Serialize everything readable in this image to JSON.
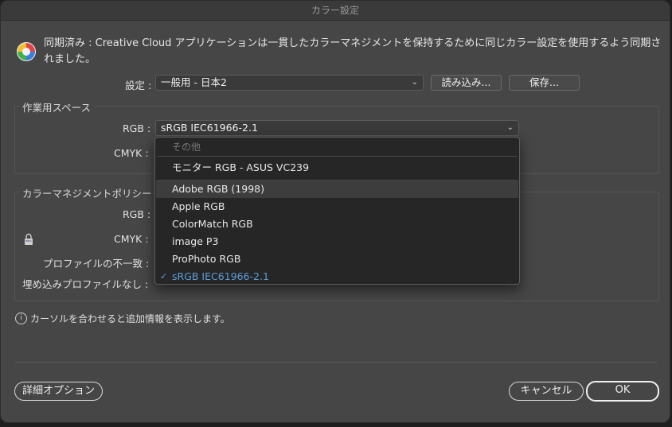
{
  "window": {
    "title": "カラー設定"
  },
  "sync": {
    "message": "同期済み : Creative Cloud アプリケーションは一貫したカラーマネジメントを保持するために同じカラー設定を使用するよう同期されました。"
  },
  "settings": {
    "label": "設定 :",
    "value": "一般用 - 日本2",
    "load_button": "読み込み...",
    "save_button": "保存..."
  },
  "working_spaces": {
    "title": "作業用スペース",
    "rgb_label": "RGB :",
    "rgb_value": "sRGB IEC61966-2.1",
    "cmyk_label": "CMYK :"
  },
  "policies": {
    "title": "カラーマネジメントポリシー",
    "rgb_label": "RGB :",
    "cmyk_label": "CMYK :",
    "mismatch_label": "プロファイルの不一致 :",
    "missing_label": "埋め込みプロファイルなし :"
  },
  "rgb_menu": {
    "header": "その他",
    "monitor": "モニター RGB - ASUS VC239",
    "items": [
      {
        "label": "Adobe RGB (1998)",
        "state": "hover"
      },
      {
        "label": "Apple RGB",
        "state": ""
      },
      {
        "label": "ColorMatch RGB",
        "state": ""
      },
      {
        "label": "image P3",
        "state": ""
      },
      {
        "label": "ProPhoto RGB",
        "state": ""
      },
      {
        "label": "sRGB IEC61966-2.1",
        "state": "selected"
      }
    ],
    "check_glyph": "✓"
  },
  "hint": {
    "text": "カーソルを合わせると追加情報を表示します。"
  },
  "footer": {
    "advanced_button": "詳細オプション",
    "cancel_button": "キャンセル",
    "ok_button": "OK"
  },
  "colors": {
    "accent": "#5b9dd8",
    "dialog_bg": "#464646",
    "menu_bg": "#262626"
  }
}
